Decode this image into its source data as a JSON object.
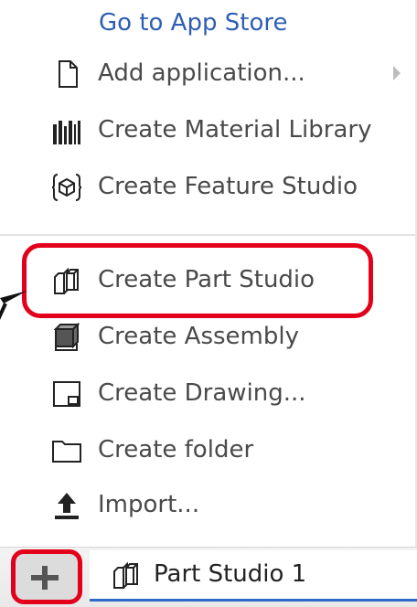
{
  "menu": {
    "app_store_link": "Go to App Store",
    "items": [
      {
        "label": "Add application...",
        "icon": "document-icon"
      },
      {
        "label": "Create Material Library",
        "icon": "library-icon"
      },
      {
        "label": "Create Feature Studio",
        "icon": "feature-studio-icon"
      },
      {
        "label": "Create Part Studio",
        "icon": "part-studio-icon"
      },
      {
        "label": "Create Assembly",
        "icon": "assembly-icon"
      },
      {
        "label": "Create Drawing...",
        "icon": "drawing-icon"
      },
      {
        "label": "Create folder",
        "icon": "folder-icon"
      },
      {
        "label": "Import...",
        "icon": "import-icon"
      }
    ]
  },
  "bottom_bar": {
    "add_button_icon": "plus-icon",
    "tab_label": "Part Studio 1",
    "tab_icon": "part-studio-icon"
  },
  "colors": {
    "link": "#2f5fb3",
    "text": "#4a4a4a",
    "highlight": "#e3001b",
    "tab_underline": "#2f69c7"
  }
}
